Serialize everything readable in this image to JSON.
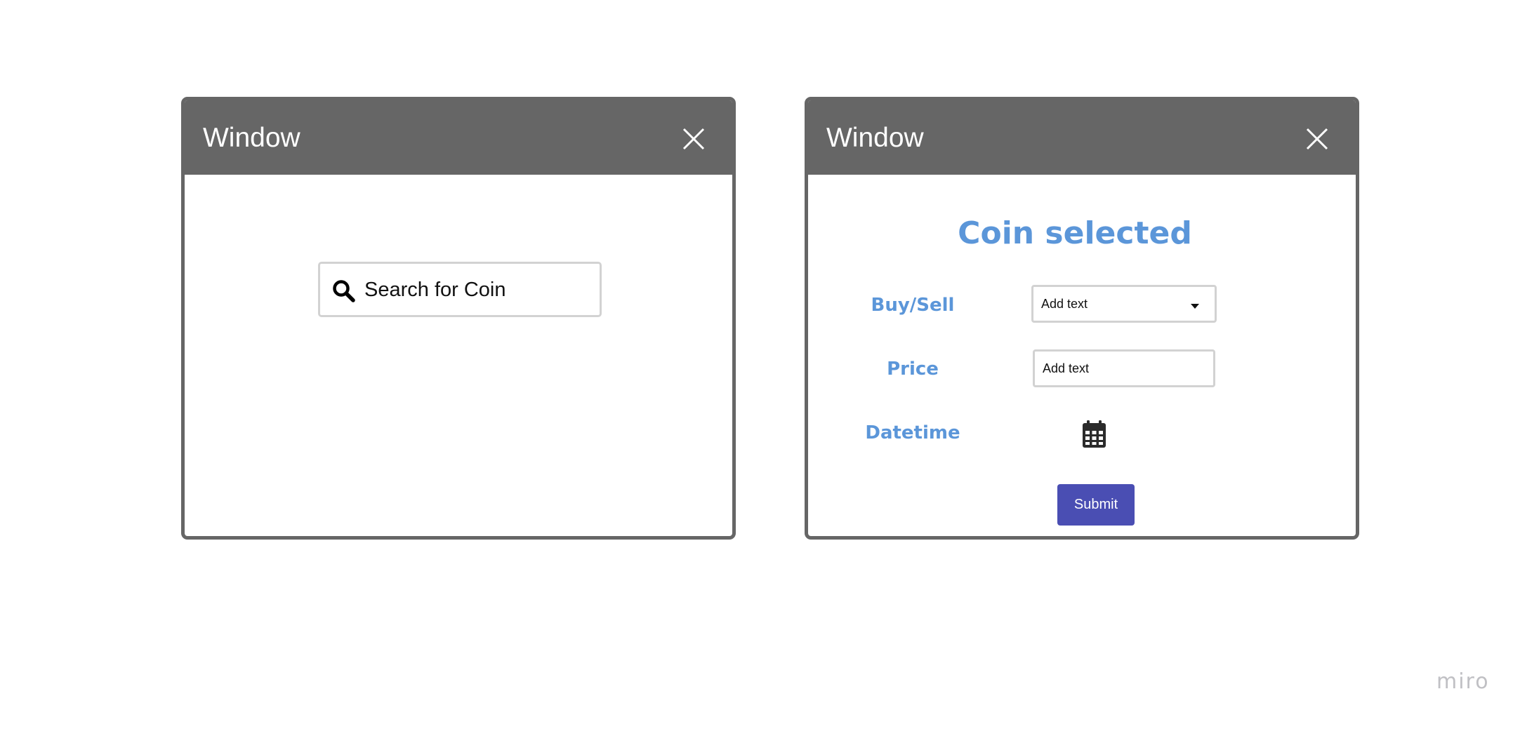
{
  "search_window": {
    "title": "Window",
    "search": {
      "placeholder": "Search for Coin",
      "icon": "search-icon"
    }
  },
  "form_window": {
    "title": "Window",
    "heading": "Coin selected",
    "fields": {
      "buy_sell": {
        "label": "Buy/Sell",
        "value": "Add text",
        "type": "dropdown"
      },
      "price": {
        "label": "Price",
        "value": "Add text",
        "type": "text"
      },
      "datetime": {
        "label": "Datetime",
        "icon": "calendar-icon"
      }
    },
    "submit_label": "Submit"
  },
  "brand": "miro",
  "colors": {
    "titlebar": "#666666",
    "label_blue": "#5b96d9",
    "submit_button": "#4a4eb3",
    "field_border": "#d2d2d2"
  }
}
